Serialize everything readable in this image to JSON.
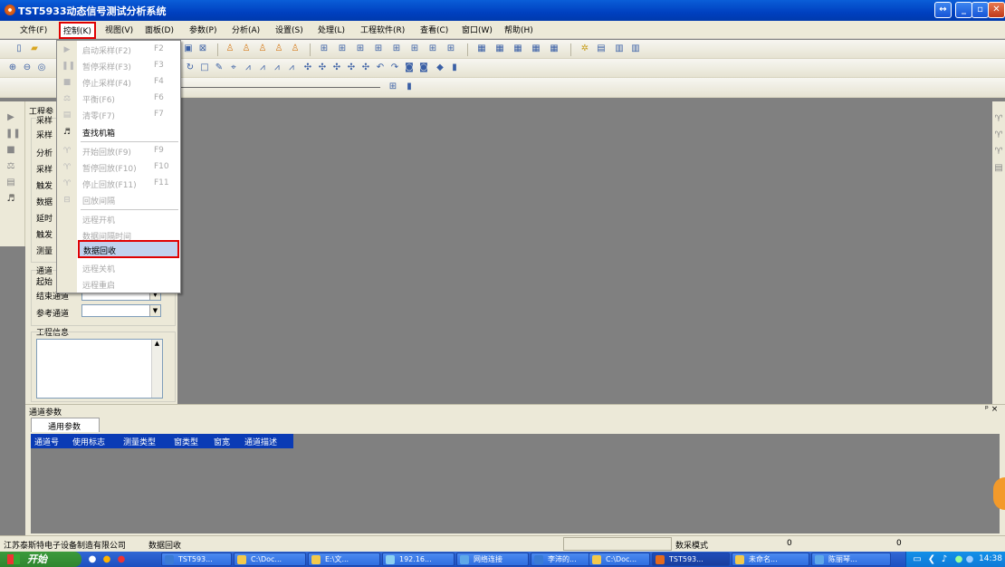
{
  "app": {
    "title": "TST5933动态信号测试分析系统"
  },
  "menubar": {
    "items": [
      {
        "label": "文件(F)"
      },
      {
        "label": "控制(K)"
      },
      {
        "label": "视图(V)"
      },
      {
        "label": "面板(D)"
      },
      {
        "label": "参数(P)"
      },
      {
        "label": "分析(A)"
      },
      {
        "label": "设置(S)"
      },
      {
        "label": "处理(L)"
      },
      {
        "label": "工程软件(R)"
      },
      {
        "label": "查看(C)"
      },
      {
        "label": "窗口(W)"
      },
      {
        "label": "帮助(H)"
      }
    ]
  },
  "control_menu": {
    "items": [
      {
        "icon": "play-icon",
        "label": "启动采样(F2)",
        "shortcut": "F2",
        "enabled": false
      },
      {
        "icon": "pause-icon",
        "label": "暂停采样(F3)",
        "shortcut": "F3",
        "enabled": false
      },
      {
        "icon": "stop-icon",
        "label": "停止采样(F4)",
        "shortcut": "F4",
        "enabled": false
      },
      {
        "icon": "balance-icon",
        "label": "平衡(F6)",
        "shortcut": "F6",
        "enabled": false
      },
      {
        "icon": "zero-icon",
        "label": "清零(F7)",
        "shortcut": "F7",
        "enabled": false
      },
      {
        "icon": "binoculars-icon",
        "label": "查找机箱",
        "shortcut": "",
        "enabled": true
      },
      {
        "icon": "playback-start-icon",
        "label": "开始回放(F9)",
        "shortcut": "F9",
        "enabled": false
      },
      {
        "icon": "playback-pause-icon",
        "label": "暂停回放(F10)",
        "shortcut": "F10",
        "enabled": false
      },
      {
        "icon": "playback-stop-icon",
        "label": "停止回放(F11)",
        "shortcut": "F11",
        "enabled": false
      },
      {
        "icon": "playback-interval-icon",
        "label": "回放间隔",
        "shortcut": "",
        "enabled": false
      },
      {
        "icon": "",
        "label": "远程开机",
        "shortcut": "",
        "enabled": false
      },
      {
        "icon": "",
        "label": "数据间隔时间",
        "shortcut": "",
        "enabled": false
      },
      {
        "icon": "",
        "label": "数据回收",
        "shortcut": "",
        "enabled": true
      },
      {
        "icon": "",
        "label": "远程关机",
        "shortcut": "",
        "enabled": false
      },
      {
        "icon": "",
        "label": "远程重启",
        "shortcut": "",
        "enabled": false
      }
    ]
  },
  "left_panel": {
    "title": "工程参",
    "sampling_group": "采样",
    "labels": [
      "采样",
      "分析",
      "采样",
      "触发",
      "数据",
      "延时",
      "触发",
      "测量"
    ],
    "channel_group": "通道",
    "start_channel": "起始",
    "end_channel": "结束通道",
    "ref_channel": "参考通道",
    "project_info": "工程信息"
  },
  "channel_params": {
    "title": "通道参数",
    "pin_label": "ᵖ ×",
    "tab": "通用参数",
    "columns": [
      "通道号",
      "使用标志",
      "测量类型",
      "窗类型",
      "窗宽",
      "通道描述"
    ]
  },
  "statusbar": {
    "company": "江苏泰斯特电子设备制造有限公司",
    "message": "数据回收",
    "mode": "数采模式",
    "value1": "0",
    "value2": "0"
  },
  "taskbar": {
    "start": "开始",
    "buttons": [
      "TST593...",
      "C:\\Doc...",
      "E:\\文...",
      "192.16...",
      "网络连接",
      "李沛的...",
      "C:\\Doc...",
      "TST593...",
      "未命名...",
      "陈丽琴..."
    ],
    "clock": "14:38"
  },
  "colors": {
    "title_bar": "#0a5ed8",
    "highlight_border": "#e00000",
    "column_header": "#0a3bb5"
  }
}
